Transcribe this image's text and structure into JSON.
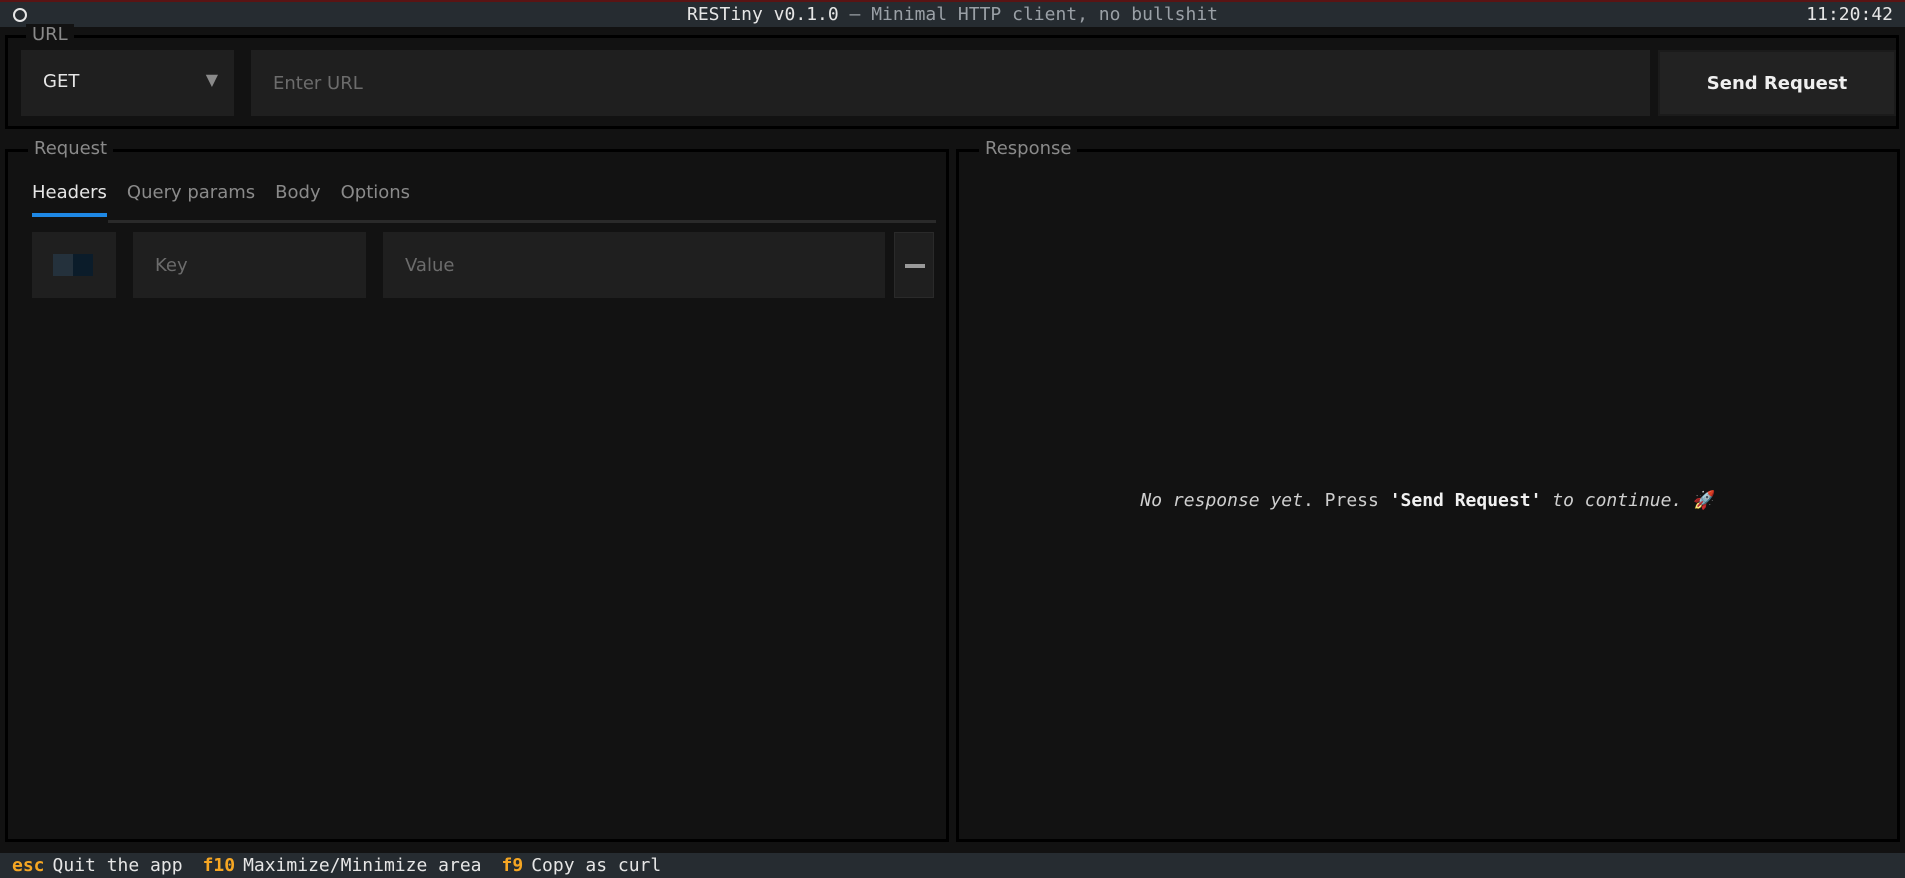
{
  "header": {
    "app_name": "RESTiny v0.1.0",
    "subtitle": "— Minimal HTTP client, no bullshit",
    "clock": "11:20:42"
  },
  "url_section": {
    "legend": "URL",
    "method": "GET",
    "url_placeholder": "Enter URL",
    "send_label": "Send Request"
  },
  "request": {
    "legend": "Request",
    "tabs": [
      "Headers",
      "Query params",
      "Body",
      "Options"
    ],
    "active_tab": "Headers",
    "header_row": {
      "key_placeholder": "Key",
      "value_placeholder": "Value"
    }
  },
  "response": {
    "legend": "Response",
    "empty_part1": "No response yet",
    "empty_part2": ". Press ",
    "empty_button": "'Send Request'",
    "empty_part3": " to continue.",
    "empty_emoji": "🚀"
  },
  "footer": {
    "items": [
      {
        "key": "esc",
        "desc": "Quit the app"
      },
      {
        "key": "f10",
        "desc": "Maximize/Minimize area"
      },
      {
        "key": "f9",
        "desc": "Copy as curl"
      }
    ]
  },
  "colors": {
    "accent": "#1e88e5",
    "shortcut_key": "#f5a623",
    "bar_bg": "#262c31"
  }
}
